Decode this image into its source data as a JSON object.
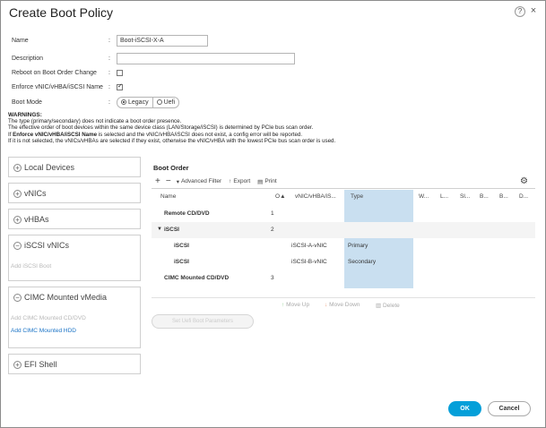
{
  "dialog": {
    "title": "Create Boot Policy",
    "help_glyph": "?",
    "close_glyph": "×"
  },
  "form": {
    "name_label": "Name",
    "name_value": "Boot-iSCSI-X-A",
    "description_label": "Description",
    "description_value": "",
    "reboot_label": "Reboot on Boot Order Change",
    "reboot_checked": false,
    "enforce_label": "Enforce vNIC/vHBA/iSCSI Name",
    "enforce_checked": true,
    "boot_mode_label": "Boot Mode",
    "boot_mode_options": [
      "Legacy",
      "Uefi"
    ],
    "boot_mode_selected": "Legacy",
    "colon": ":"
  },
  "warnings": {
    "head": "WARNINGS:",
    "line1": "The type (primary/secondary) does not indicate a boot order presence.",
    "line2": "The effective order of boot devices within the same device class (LAN/Storage/iSCSI) is determined by PCIe bus scan order.",
    "line3_pre": "If ",
    "line3_bold": "Enforce vNIC/vHBA/iSCSI Name",
    "line3_post": " is selected and the vNIC/vHBA/iSCSI does not exist, a config error will be reported.",
    "line4": "If it is not selected, the vNICs/vHBAs are selected if they exist, otherwise the vNIC/vHBA with the lowest PCIe bus scan order is used."
  },
  "left_panels": {
    "local_devices": "Local Devices",
    "vnics": "vNICs",
    "vhbas": "vHBAs",
    "iscsi_vnics": "iSCSI vNICs",
    "add_iscsi_boot": "Add iSCSI Boot",
    "cimc_media": "CIMC Mounted vMedia",
    "add_cimc_cd": "Add CIMC Mounted CD/DVD",
    "add_cimc_hdd": "Add CIMC Mounted HDD",
    "efi_shell": "EFI Shell",
    "plus_glyph": "+",
    "minus_glyph": "−"
  },
  "boot_order": {
    "title": "Boot Order",
    "toolbar": {
      "plus": "+",
      "minus": "−",
      "advanced_filter": "Advanced Filter",
      "export": "Export",
      "print": "Print"
    },
    "columns": [
      "Name",
      "Order",
      "vNIC/vHBA/iS...",
      "Type",
      "W...",
      "L...",
      "Sl...",
      "B...",
      "B...",
      "D..."
    ],
    "rows": [
      {
        "name": "Remote CD/DVD",
        "order": "1",
        "vnic": "",
        "type": ""
      },
      {
        "name": "iSCSI",
        "order": "2",
        "vnic": "",
        "type": ""
      },
      {
        "name": "iSCSI",
        "order": "",
        "vnic": "iSCSI-A-vNIC",
        "type": "Primary"
      },
      {
        "name": "iSCSI",
        "order": "",
        "vnic": "iSCSI-B-vNIC",
        "type": "Secondary"
      },
      {
        "name": "CIMC Mounted CD/DVD",
        "order": "3",
        "vnic": "",
        "type": ""
      }
    ],
    "move_up": "Move Up",
    "move_down": "Move Down",
    "delete": "Delete",
    "set_uefi": "Set Uefi Boot Parameters"
  },
  "footer": {
    "ok": "OK",
    "cancel": "Cancel"
  },
  "colors": {
    "accent": "#049fd9",
    "link": "#1a73c6",
    "type_column_highlight": "#c9dff0"
  }
}
